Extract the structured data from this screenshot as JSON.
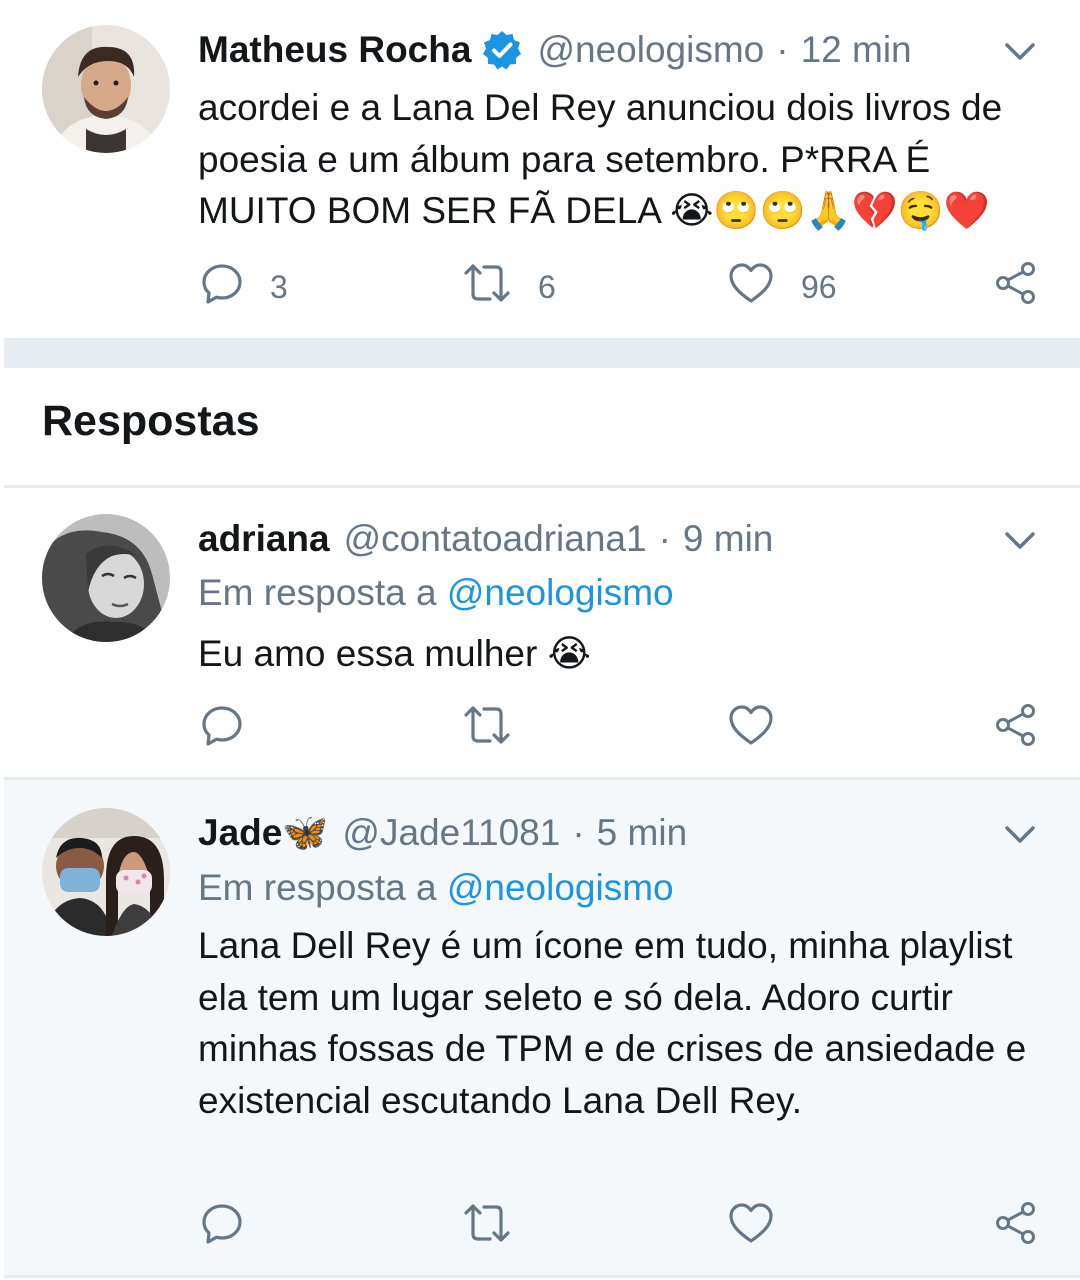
{
  "colors": {
    "accent": "#1b95e0",
    "muted": "#657786",
    "text": "#14171a",
    "separator": "#e6ecf0",
    "highlight_bg": "#f5f8fa"
  },
  "main_tweet": {
    "name": "Matheus Rocha",
    "verified": true,
    "handle": "@neologismo",
    "separator": "·",
    "time": "12 min",
    "text": "acordei e a Lana Del Rey anunciou dois livros de poesia e um álbum para setembro. P*RRA É MUITO BOM SER FÃ DELA 😭🙄🙄🙏💔🤤❤️",
    "reply_count": "3",
    "retweet_count": "6",
    "like_count": "96"
  },
  "replies_section": {
    "title": "Respostas"
  },
  "replies": [
    {
      "name": "adriana",
      "handle": "@contatoadriana1",
      "separator": "·",
      "time": "9 min",
      "reply_to_prefix": "Em resposta a",
      "reply_to_handle": "@neologismo",
      "text": "Eu amo essa mulher 😭"
    },
    {
      "name": "Jade🦋",
      "handle": "@Jade11081",
      "separator": "·",
      "time": "5 min",
      "reply_to_prefix": "Em resposta a",
      "reply_to_handle": "@neologismo",
      "text": "Lana Dell Rey é um ícone em tudo, minha playlist ela tem um lugar seleto e só dela. Adoro curtir minhas fossas de TPM e de crises de ansiedade e existencial escutando Lana Dell Rey."
    }
  ],
  "icons": {
    "reply": "reply-icon",
    "retweet": "retweet-icon",
    "like": "heart-icon",
    "share": "share-icon",
    "more": "chevron-down-icon",
    "verified": "verified-badge-icon"
  }
}
